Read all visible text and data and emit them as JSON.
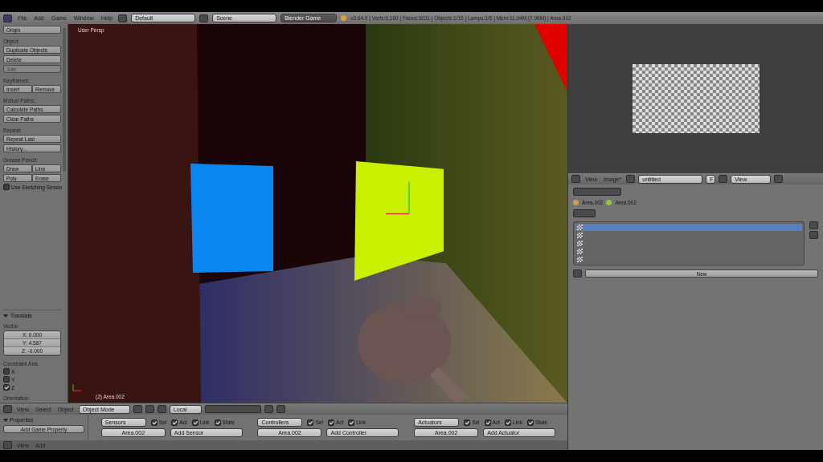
{
  "menu_bar": {
    "menus": [
      "File",
      "Add",
      "Game",
      "Window",
      "Help"
    ],
    "layout": "Default",
    "scene": "Scene",
    "engine": "Blender Game",
    "stats": "v2.64.9 | Verts:9,160 | Faces:9231 | Objects:1/15 | Lamps:1/5 | Mem:11.94M (7.96M) | Area.002"
  },
  "tool_shelf": {
    "top_button": "Origin",
    "sections": [
      {
        "title": "Object",
        "rows": [
          [
            {
              "label": "Duplicate Objects",
              "disabled": false
            }
          ],
          [
            {
              "label": "Delete",
              "disabled": false
            }
          ],
          [
            {
              "label": "Join",
              "disabled": true
            }
          ]
        ]
      },
      {
        "title": "Keyframes:",
        "rows": [
          [
            {
              "label": "Insert",
              "disabled": false
            },
            {
              "label": "Remove",
              "disabled": false
            }
          ]
        ]
      },
      {
        "title": "Motion Paths:",
        "rows": [
          [
            {
              "label": "Calculate Paths",
              "disabled": false
            }
          ],
          [
            {
              "label": "Clear Paths",
              "disabled": false
            }
          ]
        ]
      },
      {
        "title": "Repeat:",
        "rows": [
          [
            {
              "label": "Repeat Last",
              "disabled": false
            }
          ],
          [
            {
              "label": "History...",
              "disabled": false
            }
          ]
        ]
      },
      {
        "title": "Grease Pencil:",
        "rows": [
          [
            {
              "label": "Draw",
              "disabled": false
            },
            {
              "label": "Line",
              "disabled": false
            }
          ],
          [
            {
              "label": "Poly",
              "disabled": false
            },
            {
              "label": "Erase",
              "disabled": false
            }
          ]
        ]
      }
    ],
    "sketching": {
      "label": "Use Sketching Sessio",
      "checked": false
    }
  },
  "operator": {
    "title": "Translate",
    "expanded": true,
    "vector_label": "Vector",
    "vector": [
      "X: 0.000",
      "Y: 4.587",
      "Z: -0.000"
    ],
    "axis_label": "Constraint Axis",
    "axes": [
      {
        "label": "X",
        "checked": false
      },
      {
        "label": "Y",
        "checked": false
      },
      {
        "label": "Z",
        "checked": true
      }
    ],
    "cut_label": "Orientation"
  },
  "viewport": {
    "view_label": "User Persp",
    "object_label": "(2) Area.002"
  },
  "viewport_header": {
    "menus": [
      "View",
      "Select",
      "Object"
    ],
    "mode": "Object Mode",
    "orientation": "Local"
  },
  "logic": {
    "panel": {
      "title": "Properties",
      "expanded": true,
      "button": "Add Game Property"
    },
    "header_menus": [
      "View",
      "Add"
    ],
    "columns": [
      {
        "type": "Sensors",
        "filters": [
          {
            "label": "Sel",
            "checked": true
          },
          {
            "label": "Act",
            "checked": true
          },
          {
            "label": "Link",
            "checked": true
          },
          {
            "label": "State",
            "checked": true
          }
        ],
        "object": "Area.002",
        "add": "Add Sensor"
      },
      {
        "type": "Controllers",
        "filters": [
          {
            "label": "Sel",
            "checked": true
          },
          {
            "label": "Act",
            "checked": true
          },
          {
            "label": "Link",
            "checked": true
          }
        ],
        "object": "Area.002",
        "add": "Add Controller"
      },
      {
        "type": "Actuators",
        "filters": [
          {
            "label": "Sel",
            "checked": true
          },
          {
            "label": "Act",
            "checked": true
          },
          {
            "label": "Link",
            "checked": true
          },
          {
            "label": "State",
            "checked": true
          }
        ],
        "object": "Area.002",
        "add": "Add Actuator"
      }
    ]
  },
  "image_editor": {
    "menus": [
      "View",
      "Image*"
    ],
    "image_name": "untitled",
    "fake_user": "F",
    "display": "View"
  },
  "properties": {
    "breadcrumb": [
      "Area.002",
      "Area.002"
    ],
    "slots": [
      {
        "selected": true
      },
      {
        "selected": false
      },
      {
        "selected": false
      },
      {
        "selected": false
      },
      {
        "selected": false
      }
    ],
    "new_button": "New"
  }
}
